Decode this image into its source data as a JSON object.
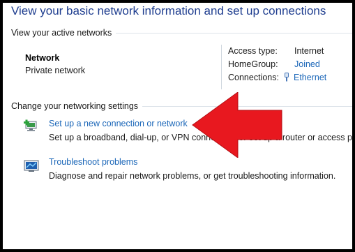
{
  "header": {
    "title": "View your basic network information and set up connections"
  },
  "active_networks": {
    "heading": "View your active networks",
    "network_name": "Network",
    "network_type": "Private network",
    "properties": {
      "access_type_label": "Access type:",
      "access_type_value": "Internet",
      "homegroup_label": "HomeGroup:",
      "homegroup_value": "Joined",
      "connections_label": "Connections:",
      "connections_value": "Ethernet"
    }
  },
  "settings": {
    "heading": "Change your networking settings",
    "tasks": [
      {
        "label": "Set up a new connection or network",
        "description": "Set up a broadband, dial-up, or VPN connection; or set up a router or access point."
      },
      {
        "label": "Troubleshoot problems",
        "description": "Diagnose and repair network problems, or get troubleshooting information."
      }
    ]
  },
  "icons": {
    "setup": "network-setup-icon",
    "troubleshoot": "troubleshoot-icon",
    "connection": "ethernet-icon",
    "annotation": "red-arrow"
  },
  "colors": {
    "accent": "#1a66b8",
    "title": "#1e3d8f",
    "arrow": "#e8181f"
  }
}
